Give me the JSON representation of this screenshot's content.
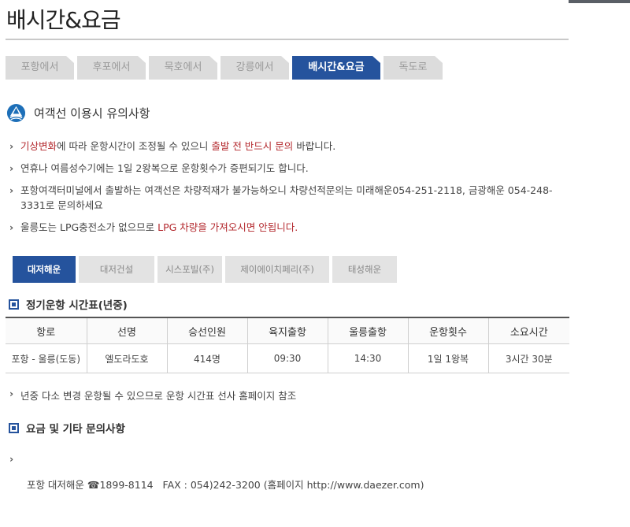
{
  "page": {
    "title": "배시간&요금"
  },
  "tabs": [
    {
      "label": "포항에서"
    },
    {
      "label": "후포에서"
    },
    {
      "label": "묵호에서"
    },
    {
      "label": "강릉에서"
    },
    {
      "label": "배시간&요금",
      "active": true
    },
    {
      "label": "독도로"
    }
  ],
  "notice_section": {
    "heading": "여객선 이용시 유의사항",
    "items": [
      {
        "parts": [
          "기상변화",
          "에 따라 운항시간이 조정될 수 있으니 ",
          "출발 전 반드시 문의",
          " 바랍니다."
        ]
      },
      {
        "text": "연휴나 여름성수기에는 1일 2왕복으로 운항횟수가 증편되기도 합니다."
      },
      {
        "text": "포항여객터미널에서 출발하는 여객선은 차량적재가 불가능하오니 차량선적문의는 미래해운054-251-2118, 금광해운 054-248-3331로 문의하세요"
      },
      {
        "parts": [
          "울릉도는 LPG충전소가 없으므로 ",
          "LPG 차량을 가져오시면 안됩니다."
        ]
      }
    ]
  },
  "company_tabs": [
    {
      "label": "대저해운",
      "active": true
    },
    {
      "label": "대저건설"
    },
    {
      "label": "시스포빌(주)"
    },
    {
      "label": "제이에이치페리(주)"
    },
    {
      "label": "태성해운"
    }
  ],
  "schedule": {
    "heading": "정기운항 시간표(년중)",
    "columns": [
      "항로",
      "선명",
      "승선인원",
      "육지출항",
      "울릉출항",
      "운항횟수",
      "소요시간"
    ],
    "rows": [
      [
        "포항 - 울릉(도동)",
        "엘도라도호",
        "414명",
        "09:30",
        "14:30",
        "1일 1왕복",
        "3시간 30분"
      ]
    ],
    "note": "년중 다소 변경 운항될 수 있으므로 운항 시간표 선사 홈페이지 참조"
  },
  "fare_section": {
    "heading": "요금 및 기타 문의사항",
    "contact": "포항 대저해운 ☎1899-8114   FAX : 054)242-3200 (홈페이지 http://www.daezer.com)"
  },
  "colors": {
    "accent": "#25539d",
    "warning_red": "#b3282d",
    "tab_inactive": "#dcdcdc"
  },
  "icons": {
    "section_logo": "ship-logo-icon",
    "sub_heading": "square-bullet-icon",
    "bullet": "chevron-right-icon"
  }
}
